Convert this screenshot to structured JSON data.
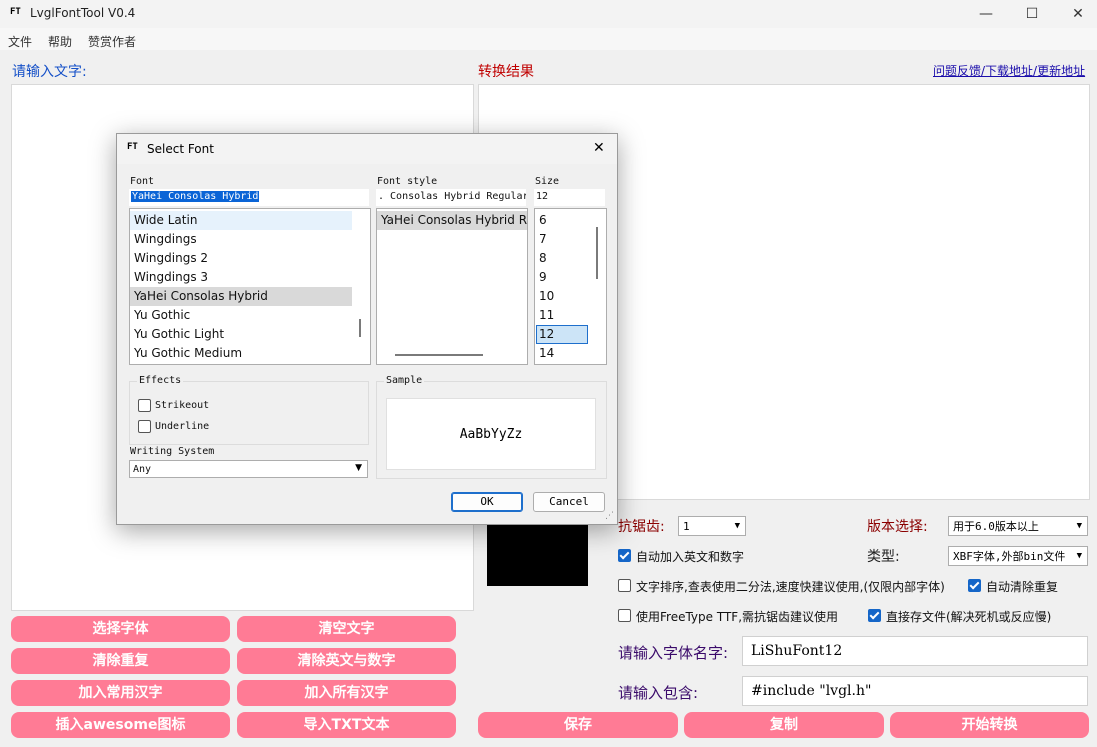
{
  "window": {
    "title": "LvglFontTool V0.4",
    "icon_text": "FT",
    "minimize_glyph": "—",
    "maximize_glyph": "☐",
    "close_glyph": "✕"
  },
  "menu": {
    "items": [
      "文件",
      "帮助",
      "赞赏作者"
    ]
  },
  "input_panel": {
    "label": "请输入文字:"
  },
  "result_panel": {
    "label": "转换结果",
    "link": "问题反馈/下载地址/更新地址"
  },
  "left_buttons": [
    "选择字体",
    "清空文字",
    "清除重复",
    "清除英文与数字",
    "加入常用汉字",
    "加入所有汉字",
    "插入awesome图标",
    "导入TXT文本"
  ],
  "options": {
    "antialias_label": "抗锯齿:",
    "antialias_value": "1",
    "version_label": "版本选择:",
    "version_value": "用于6.0版本以上",
    "type_label": "类型:",
    "type_value": "XBF字体,外部bin文件",
    "checkboxes": [
      {
        "label": "自动加入英文和数字",
        "checked": true
      },
      {
        "label": "文字排序,查表使用二分法,速度快建议使用,(仅限内部字体)",
        "checked": false
      },
      {
        "label": "自动清除重复",
        "checked": true
      },
      {
        "label": "使用FreeType TTF,需抗锯齿建议使用",
        "checked": false
      },
      {
        "label": "直接存文件(解决死机或反应慢)",
        "checked": true
      }
    ],
    "font_name_label": "请输入字体名字:",
    "font_name_value": "LiShuFont12",
    "include_label": "请输入包含:",
    "include_value": "#include \"lvgl.h\""
  },
  "bottom_buttons": [
    "保存",
    "复制",
    "开始转换"
  ],
  "preview_color": "#000000",
  "accent_pink": "#ff7b95",
  "dialog": {
    "title": "Select Font",
    "icon_text": "FT",
    "close_glyph": "✕",
    "font_label": "Font",
    "font_value": "YaHei Consolas Hybrid",
    "font_list": [
      "Wide Latin",
      "Wingdings",
      "Wingdings 2",
      "Wingdings 3",
      "YaHei Consolas Hybrid",
      "Yu Gothic",
      "Yu Gothic Light",
      "Yu Gothic Medium"
    ],
    "selected_font": "YaHei Consolas Hybrid",
    "style_label": "Font style",
    "style_value": ". Consolas Hybrid Regular",
    "style_list": [
      "YaHei Consolas Hybrid R"
    ],
    "size_label": "Size",
    "size_value": "12",
    "size_list": [
      "6",
      "7",
      "8",
      "9",
      "10",
      "11",
      "12",
      "14"
    ],
    "selected_size": "12",
    "effects_label": "Effects",
    "strikeout_label": "Strikeout",
    "underline_label": "Underline",
    "writing_system_label": "Writing System",
    "writing_system_value": "Any",
    "sample_label": "Sample",
    "sample_text": "AaBbYyZz",
    "ok_label": "OK",
    "cancel_label": "Cancel"
  }
}
